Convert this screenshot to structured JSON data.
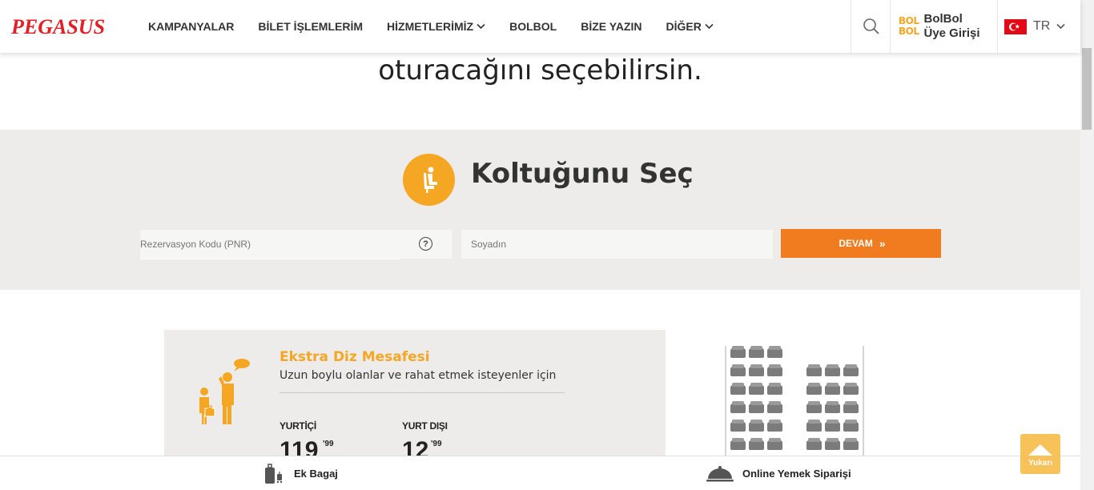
{
  "header": {
    "logo_text": "PEGASUS",
    "nav": [
      {
        "label": "KAMPANYALAR",
        "has_dropdown": false
      },
      {
        "label": "BİLET İŞLEMLERİM",
        "has_dropdown": false
      },
      {
        "label": "HİZMETLERİMİZ",
        "has_dropdown": true
      },
      {
        "label": "BOLBOL",
        "has_dropdown": false
      },
      {
        "label": "BİZE YAZIN",
        "has_dropdown": false
      },
      {
        "label": "DİĞER",
        "has_dropdown": true
      }
    ],
    "bolbol_logo_top": "BOL",
    "bolbol_logo_bottom": "BOL",
    "bolbol_line1": "BolBol",
    "bolbol_line2": "Üye Girişi",
    "language": "TR"
  },
  "hero": {
    "text": "oturacağını seçebilirsin."
  },
  "seat_select": {
    "title": "Koltuğunu Seç",
    "pnr_placeholder": "Rezervasyon Kodu (PNR)",
    "help_symbol": "?",
    "lastname_placeholder": "Soyadın",
    "submit_label": "DEVAM",
    "submit_arrows": "»"
  },
  "extra_legroom": {
    "title": "Ekstra Diz Mesafesi",
    "subtitle": "Uzun boylu olanlar ve rahat etmek isteyenler için",
    "domestic_label": "YURTİÇİ",
    "domestic_price_main": "119",
    "domestic_price_cents": "'99",
    "international_label": "YURT DIŞI",
    "international_price_main": "12",
    "international_price_cents": "'99"
  },
  "bottom_bar": {
    "extra_bag_label": "Ek Bagaj",
    "meal_label": "Online Yemek Siparişi"
  },
  "up_button": {
    "label": "Yukarı"
  },
  "colors": {
    "brand_red": "#e31e24",
    "accent_orange": "#f07c1f",
    "accent_yellow": "#f5a623",
    "band_gray": "#edecea"
  }
}
